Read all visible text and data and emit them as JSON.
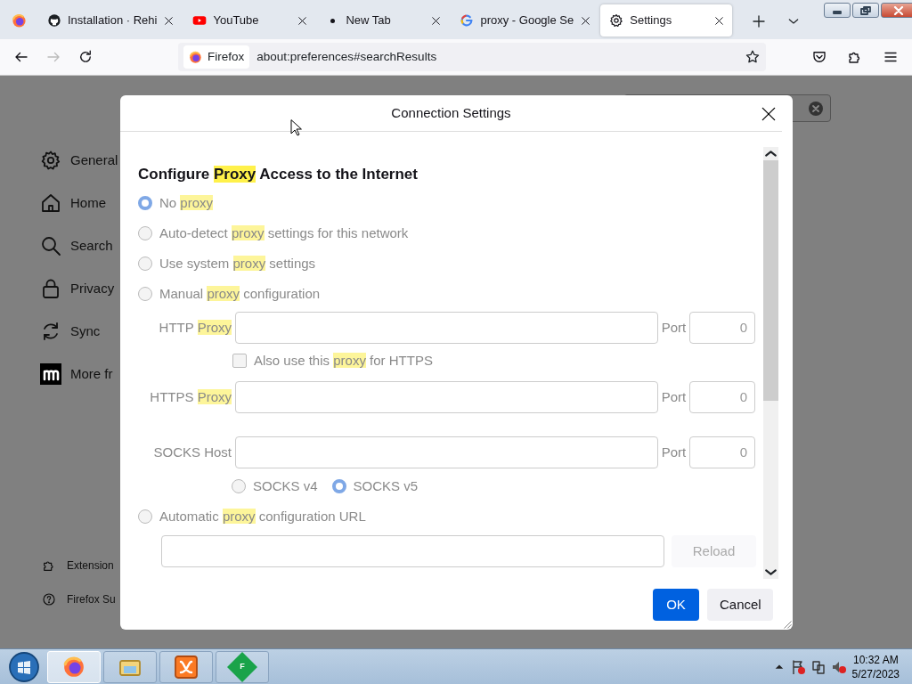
{
  "browser": {
    "tabs": [
      {
        "title": "Installation · Rehi",
        "kind": "github",
        "selected": false
      },
      {
        "title": "YouTube",
        "kind": "youtube",
        "selected": false
      },
      {
        "title": "New Tab",
        "kind": "dot",
        "selected": false
      },
      {
        "title": "proxy - Google Se",
        "kind": "google",
        "selected": false
      },
      {
        "title": "Settings",
        "kind": "gear",
        "selected": true
      }
    ],
    "nav": {
      "forward_disabled": true
    },
    "url_bar": {
      "identity": "Firefox",
      "url": "about:preferences#searchResults"
    }
  },
  "sidebar": {
    "items": [
      {
        "label": "General",
        "kind": "gear"
      },
      {
        "label": "Home",
        "kind": "home"
      },
      {
        "label": "Search",
        "kind": "search"
      },
      {
        "label": "Privacy",
        "kind": "lock"
      },
      {
        "label": "Sync",
        "kind": "sync"
      },
      {
        "label": "More fr",
        "kind": "mozilla"
      }
    ],
    "footer": [
      {
        "label": "Extension",
        "kind": "puzzle"
      },
      {
        "label": "Firefox Su",
        "kind": "help"
      }
    ]
  },
  "dialog": {
    "title": "Connection Settings",
    "heading": [
      {
        "text": "Configure ",
        "highlight": false
      },
      {
        "text": "Proxy",
        "highlight": true
      },
      {
        "text": " Access to the Internet",
        "highlight": false
      }
    ],
    "options": [
      {
        "label": [
          {
            "text": "No ",
            "highlight": false
          },
          {
            "text": "proxy",
            "highlight": true
          }
        ],
        "selected": true
      },
      {
        "label": [
          {
            "text": "Auto-detect ",
            "highlight": false
          },
          {
            "text": "proxy",
            "highlight": true
          },
          {
            "text": " settings for this network",
            "highlight": false
          }
        ],
        "selected": false
      },
      {
        "label": [
          {
            "text": "Use system ",
            "highlight": false
          },
          {
            "text": "proxy",
            "highlight": true
          },
          {
            "text": " settings",
            "highlight": false
          }
        ],
        "selected": false
      },
      {
        "label": [
          {
            "text": "Manual ",
            "highlight": false
          },
          {
            "text": "proxy",
            "highlight": true
          },
          {
            "text": " configuration",
            "highlight": false
          }
        ],
        "selected": false
      }
    ],
    "manual_rows": [
      {
        "kind": "host",
        "label": [
          {
            "text": "HTTP ",
            "highlight": false
          },
          {
            "text": "Proxy",
            "highlight": true
          }
        ],
        "port_label": "Port",
        "port": "0"
      },
      {
        "kind": "checkbox",
        "label": [
          {
            "text": "Also use this ",
            "highlight": false
          },
          {
            "text": "proxy",
            "highlight": true
          },
          {
            "text": " for HTTPS",
            "highlight": false
          }
        ],
        "checked": false
      },
      {
        "kind": "host",
        "label": [
          {
            "text": "HTTPS ",
            "highlight": false
          },
          {
            "text": "Proxy",
            "highlight": true
          }
        ],
        "port_label": "Port",
        "port": "0"
      },
      {
        "kind": "host",
        "label": [
          {
            "text": "SOCKS Host",
            "highlight": false
          }
        ],
        "port_label": "Port",
        "port": "0"
      },
      {
        "kind": "radios",
        "options": [
          {
            "label": "SOCKS v4",
            "selected": false
          },
          {
            "label": "SOCKS v5",
            "selected": true
          }
        ]
      }
    ],
    "auto": {
      "label": [
        {
          "text": "Automatic ",
          "highlight": false
        },
        {
          "text": "proxy",
          "highlight": true
        },
        {
          "text": " configuration URL",
          "highlight": false
        }
      ],
      "selected": false,
      "reload": {
        "label": "Reload",
        "disabled": true
      }
    },
    "buttons": [
      {
        "label": "OK",
        "kind": "primary"
      },
      {
        "label": "Cancel",
        "kind": "secondary"
      }
    ]
  },
  "taskbar": {
    "apps": [
      {
        "kind": "firefox",
        "active": true
      },
      {
        "kind": "folder",
        "active": false
      },
      {
        "kind": "xampp",
        "active": false
      },
      {
        "kind": "diamond",
        "text": "F",
        "active": false
      }
    ],
    "time": "10:32 AM",
    "date": "5/27/2023"
  }
}
